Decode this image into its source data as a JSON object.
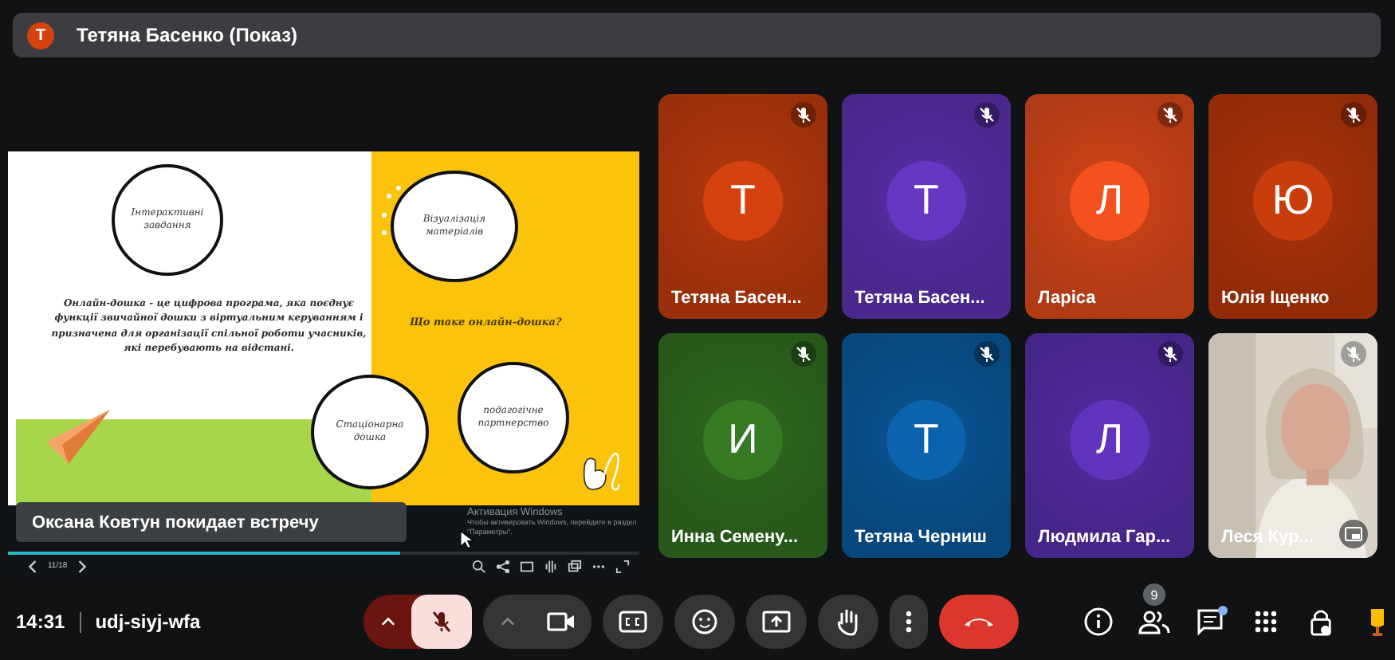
{
  "presenter_bar": {
    "initial": "Т",
    "label": "Тетяна Басенко (Показ)"
  },
  "slide": {
    "bubbles": [
      "Інтерактивні завдання",
      "Візуалізація матеріалів",
      "Стаціонарна дошка",
      "подагогічне партнерство"
    ],
    "definition": "Онлайн-дошка - це цифрова програма, яка поєднує функції звичайної дошки з віртуальним керуванням і призначена для організації спільної роботи учасників, які перебувають на відстані.",
    "question": "Що таке онлайн-дошка?"
  },
  "notification": "Оксана Ковтун покидает встречу",
  "windows_notice": {
    "title": "Активация Windows",
    "text": "Чтобы активировать Windows, перейдите в раздел \"Параметры\"."
  },
  "viewer": {
    "page": "11/18",
    "level": 0.62
  },
  "tiles": [
    {
      "kind": "avatar",
      "name": "Тетяна Басен...",
      "initial": "Т",
      "color": "#d5420f",
      "muted": true
    },
    {
      "kind": "avatar",
      "name": "Тетяна Басен...",
      "initial": "Т",
      "color": "#6637c2",
      "muted": true
    },
    {
      "kind": "avatar",
      "name": "Ларіса",
      "initial": "Л",
      "color": "#f4511e",
      "muted": true
    },
    {
      "kind": "avatar",
      "name": "Юлія Іщенко",
      "initial": "Ю",
      "color": "#c93c0c",
      "muted": true
    },
    {
      "kind": "avatar",
      "name": "Инна Семену...",
      "initial": "И",
      "color": "#377a24",
      "muted": true
    },
    {
      "kind": "avatar",
      "name": "Тетяна Черниш",
      "initial": "Т",
      "color": "#0b63ad",
      "muted": true
    },
    {
      "kind": "avatar",
      "name": "Людмила Гар...",
      "initial": "Л",
      "color": "#6134bd",
      "muted": true
    },
    {
      "kind": "video",
      "name": "Леся Кур...",
      "muted": true
    }
  ],
  "meeting": {
    "time": "14:31",
    "code": "udj-siyj-wfa"
  },
  "controls": {
    "mic_muted": true,
    "people_count": "9",
    "chat_unread": true
  }
}
